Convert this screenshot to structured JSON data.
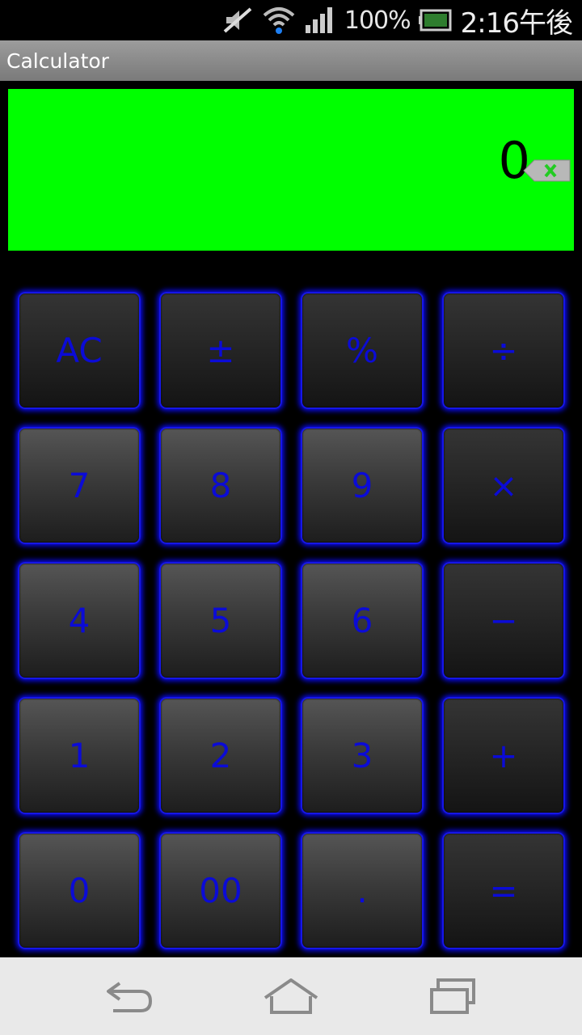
{
  "status_bar": {
    "battery_percent": "100%",
    "time": "2:16午後",
    "icons": [
      "mute-icon",
      "wifi-icon",
      "signal-icon",
      "battery-icon"
    ]
  },
  "app": {
    "title": "Calculator"
  },
  "display": {
    "value": "0",
    "backspace_icon": "backspace-icon",
    "background_color": "#00ff00"
  },
  "keypad": {
    "accent_color": "#0b0bd6",
    "rows": [
      [
        "AC",
        "±",
        "%",
        "÷"
      ],
      [
        "7",
        "8",
        "9",
        "×"
      ],
      [
        "4",
        "5",
        "6",
        "−"
      ],
      [
        "1",
        "2",
        "3",
        "+"
      ],
      [
        "0",
        "00",
        ".",
        "="
      ]
    ]
  },
  "nav_bar": {
    "icons": [
      "back-icon",
      "home-icon",
      "recent-apps-icon"
    ]
  }
}
